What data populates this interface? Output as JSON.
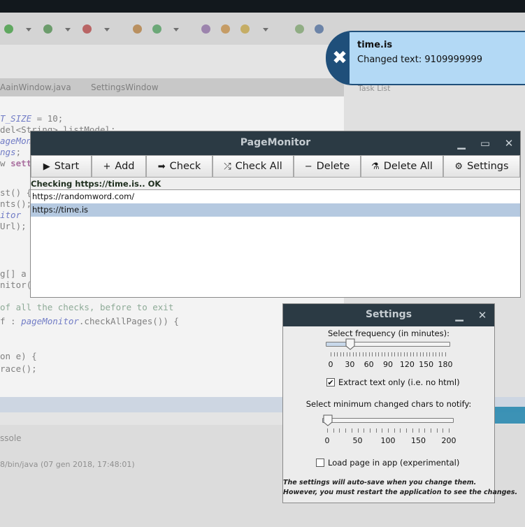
{
  "notification": {
    "title": "time.is",
    "body": "Changed text: 9109999999",
    "icon": "close-icon"
  },
  "background_ide": {
    "tabs": [
      "AainWindow.java",
      "SettingsWindow"
    ],
    "right_tab": "Task List",
    "console_tab": "ssole",
    "console_line": "8/bin/java (07 gen 2018, 17:48:01)"
  },
  "page_monitor": {
    "title": "PageMonitor",
    "toolbar": [
      {
        "label": "Start",
        "icon": "play-icon",
        "glyph": "▶"
      },
      {
        "label": "Add",
        "icon": "plus-icon",
        "glyph": "+"
      },
      {
        "label": "Check",
        "icon": "arrow-right-icon",
        "glyph": "➡"
      },
      {
        "label": "Check All",
        "icon": "shuffle-icon",
        "glyph": "⤮"
      },
      {
        "label": "Delete",
        "icon": "minus-icon",
        "glyph": "−"
      },
      {
        "label": "Delete All",
        "icon": "broom-icon",
        "glyph": "⚗"
      },
      {
        "label": "Settings",
        "icon": "gear-icon",
        "glyph": "⚙"
      }
    ],
    "status": "Checking https://time.is.. OK",
    "urls": [
      {
        "url": "https://randomword.com/",
        "selected": false
      },
      {
        "url": "https://time.is",
        "selected": true
      }
    ]
  },
  "settings": {
    "title": "Settings",
    "frequency": {
      "label": "Select frequency (in minutes):",
      "value": 30,
      "min": 0,
      "max": 180,
      "ticks": [
        "0",
        "30",
        "60",
        "90",
        "120",
        "150",
        "180"
      ]
    },
    "extract_text": {
      "label": "Extract text only (i.e. no html)",
      "checked": true
    },
    "min_chars": {
      "label": "Select minimum changed chars to notify:",
      "value": 0,
      "min": 0,
      "max": 200,
      "ticks": [
        "0",
        "50",
        "100",
        "150",
        "200"
      ]
    },
    "load_in_app": {
      "label": "Load page in app (experimental)",
      "checked": false
    },
    "note_line1": "The settings will auto-save when you change them.",
    "note_line2": "However, you must restart the application to see the changes."
  },
  "colors": {
    "title_bar": "#2b3a44",
    "notification_bg": "#b3d9f5",
    "notification_border": "#1f4f7a",
    "selection": "#b5c9e0"
  }
}
